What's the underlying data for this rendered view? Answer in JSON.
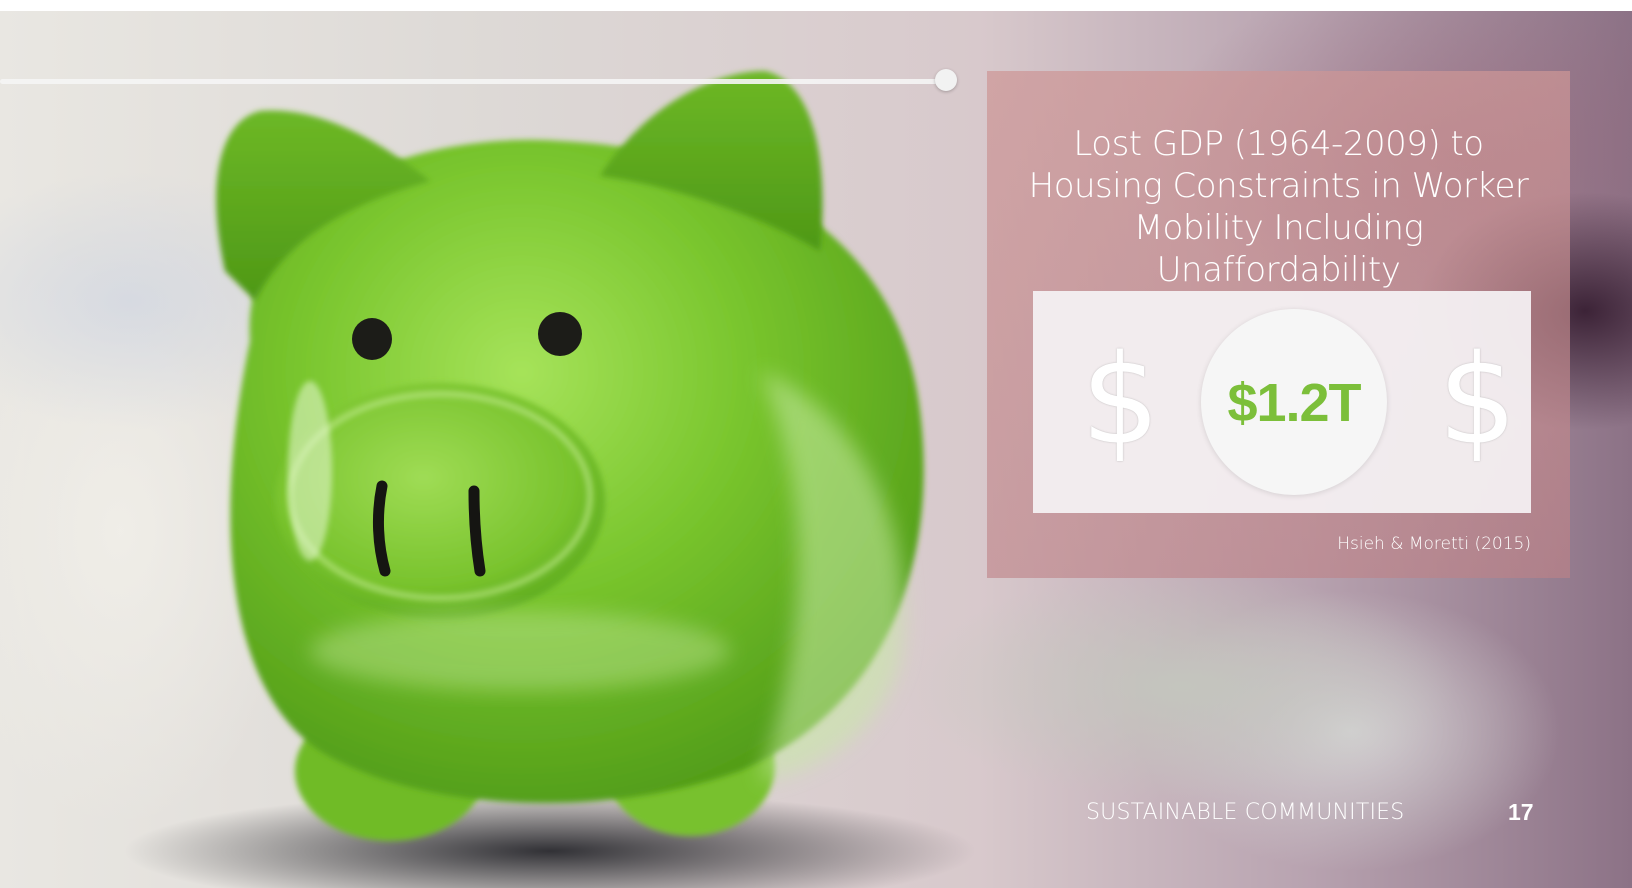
{
  "panel": {
    "title": "Lost GDP (1964-2009) to Housing Constraints in Worker Mobility Including Unaffordability",
    "stat_value": "$1.2T",
    "dollar_glyph": "$",
    "citation": "Hsieh & Moretti (2015)"
  },
  "footer": {
    "title": "SUSTAINABLE COMMUNITIES",
    "page_number": "17"
  },
  "colors": {
    "accent_green": "#7cbf3a",
    "pig_green": "#7ac62e",
    "panel_tint": "#cd9696"
  },
  "image": {
    "subject_icon": "piggy-bank-icon"
  }
}
